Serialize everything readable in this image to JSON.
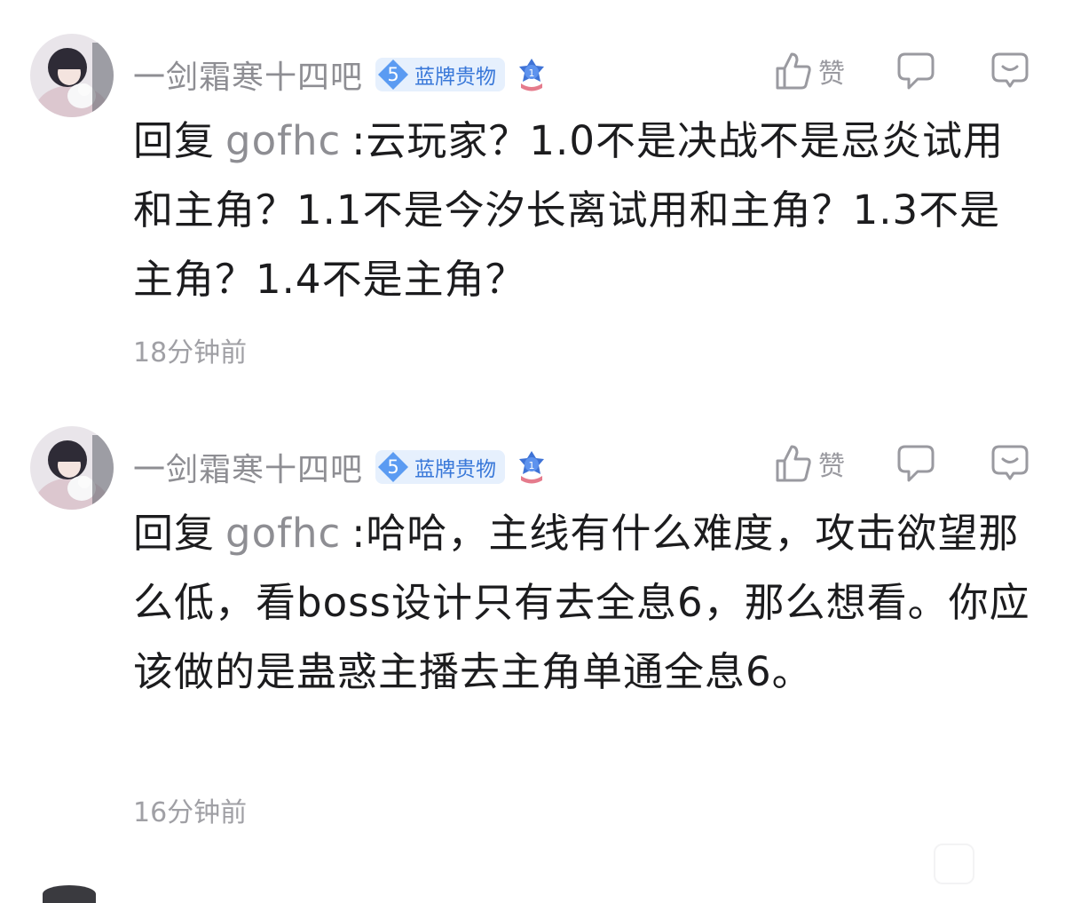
{
  "comments": [
    {
      "username": "一剑霜寒十四吧",
      "badge_level": "5",
      "badge_text": "蓝牌贵物",
      "medal_rank": "1",
      "like_label": "赞",
      "reply_prefix": "回复",
      "reply_target": "gofhc",
      "text": ":云玩家？1.0不是决战不是忌炎试用和主角？1.1不是今汐长离试用和主角？1.3不是主角？1.4不是主角？",
      "time": "18分钟前"
    },
    {
      "username": "一剑霜寒十四吧",
      "badge_level": "5",
      "badge_text": "蓝牌贵物",
      "medal_rank": "1",
      "like_label": "赞",
      "reply_prefix": "回复",
      "reply_target": "gofhc",
      "text": ":哈哈，主线有什么难度，攻击欲望那么低，看boss设计只有去全息6，那么想看。你应该做的是蛊惑主播去主角单通全息6。",
      "time": "16分钟前"
    }
  ],
  "icons": {
    "like": "thumbs-up-icon",
    "reply": "reply-bubble-icon",
    "more": "comment-more-icon",
    "medal": "star-medal-icon"
  },
  "colors": {
    "username": "#8e8e93",
    "badge_bg": "#e6f0fd",
    "badge_text": "#3978d9",
    "badge_diamond": "#5b9bf2",
    "text": "#1c1c1e",
    "muted": "#a0a0a5"
  }
}
